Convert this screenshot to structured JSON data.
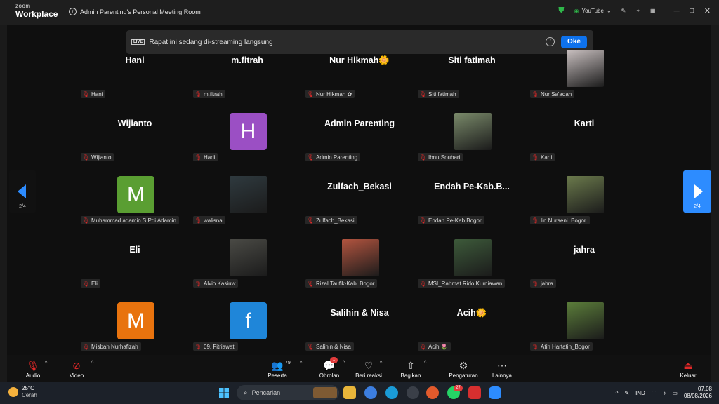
{
  "app": {
    "logo_small": "zoom",
    "logo_big": "Workplace",
    "meeting_title": "Admin Parenting's Personal Meeting Room",
    "stream_label": "YouTube"
  },
  "banner": {
    "live": "LIVE",
    "text": "Rapat ini sedang di-streaming langsung",
    "ok": "Oke"
  },
  "tiles": [
    {
      "name": "Hani",
      "label": "Hani",
      "kind": "name"
    },
    {
      "name": "m.fitrah",
      "label": "m.fitrah",
      "kind": "name"
    },
    {
      "name": "Nur  Hikmah🌼",
      "label": "Nur Hikmah ✿",
      "kind": "name"
    },
    {
      "name": "Siti fatimah",
      "label": "Siti fatimah",
      "kind": "name"
    },
    {
      "name": "",
      "label": "Nur Sa'adah",
      "kind": "photo",
      "color": "#c9c0c0"
    },
    {
      "name": "Wijianto",
      "label": "Wijianto",
      "kind": "name"
    },
    {
      "name": "H",
      "label": "Hadi",
      "kind": "avatar",
      "color": "#9b4fc4"
    },
    {
      "name": "Admin Parenting",
      "label": "Admin Parenting",
      "kind": "name"
    },
    {
      "name": "",
      "label": "Ibnu Soubari",
      "kind": "photo",
      "color": "#7a8a6a"
    },
    {
      "name": "Karti",
      "label": "Karti",
      "kind": "name"
    },
    {
      "name": "M",
      "label": "Muhammad adamin.S.Pdi Adamin",
      "kind": "avatar",
      "color": "#5a9e32"
    },
    {
      "name": "",
      "label": "walisna",
      "kind": "photo",
      "color": "#2f3a3f"
    },
    {
      "name": "Zulfach_Bekasi",
      "label": "Zulfach_Bekasi",
      "kind": "name"
    },
    {
      "name": "Endah  Pe-Kab.B...",
      "label": "Endah Pe-Kab.Bogor",
      "kind": "name"
    },
    {
      "name": "",
      "label": "Iin Nuraeni. Bogor.",
      "kind": "photo",
      "color": "#6b7a4c"
    },
    {
      "name": "Eli",
      "label": "Eli",
      "kind": "name"
    },
    {
      "name": "",
      "label": "Alvio Kasiuw",
      "kind": "photo",
      "color": "#4a4a45"
    },
    {
      "name": "",
      "label": "Rizal Taufik-Kab. Bogor",
      "kind": "photo",
      "color": "#b2543f"
    },
    {
      "name": "",
      "label": "MSI_Rahmat Rido Kurniawan",
      "kind": "photo",
      "color": "#3d5a3a"
    },
    {
      "name": "jahra",
      "label": "jahra",
      "kind": "name"
    },
    {
      "name": "M",
      "label": "Misbah Nurhafizah",
      "kind": "avatar",
      "color": "#e8730e"
    },
    {
      "name": "f",
      "label": "09. Fitriawati",
      "kind": "avatar",
      "color": "#1f86d9"
    },
    {
      "name": "Salihin & Nisa",
      "label": "Salihin & Nisa",
      "kind": "name"
    },
    {
      "name": "Acih🌼",
      "label": "Acih 🌷",
      "kind": "name"
    },
    {
      "name": "",
      "label": "Atih Hartatih_Bogor",
      "kind": "photo",
      "color": "#5b7d3a"
    }
  ],
  "nav": {
    "left_page": "2/4",
    "right_page": "2/4"
  },
  "controls": {
    "audio": "Audio",
    "video": "Video",
    "participants": "Peserta",
    "participants_count": "79",
    "chat": "Obrolan",
    "chat_badge": "1",
    "reactions": "Beri reaksi",
    "share": "Bagikan",
    "settings": "Pengaturan",
    "more": "Lainnya",
    "leave": "Keluar"
  },
  "taskbar": {
    "temp": "25°C",
    "weather": "Cerah",
    "search": "Pencarian",
    "lang": "IND",
    "time": "07.08",
    "date": "08/08/2026",
    "badge": "27"
  }
}
